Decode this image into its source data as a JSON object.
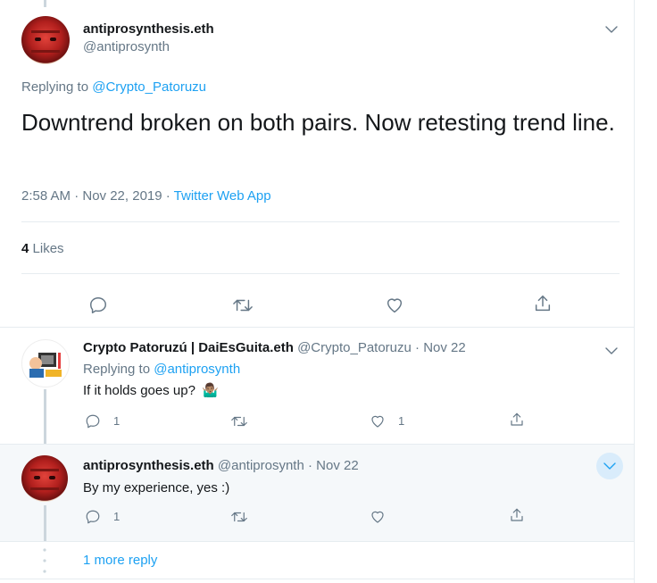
{
  "main_tweet": {
    "display_name": "antiprosynthesis.eth",
    "handle": "@antiprosynth",
    "replying_prefix": "Replying to",
    "replying_to": "@Crypto_Patoruzu",
    "text": "Downtrend broken on both pairs. Now retesting trend line.",
    "time": "2:58 AM · Nov 22, 2019 ·",
    "source": "Twitter Web App",
    "likes_count": "4",
    "likes_label": "Likes"
  },
  "reply1": {
    "display_name": "Crypto Patoruzú | DaiEsGuita.eth",
    "handle_date": "@Crypto_Patoruzu · Nov 22",
    "replying_prefix": "Replying to",
    "replying_to": "@antiprosynth",
    "text": "If it holds goes up?",
    "emoji": "🤷🏽‍♂️",
    "reply_count": "1",
    "like_count": "1"
  },
  "reply2": {
    "display_name": "antiprosynthesis.eth",
    "handle_date": "@antiprosynth · Nov 22",
    "text": "By my experience, yes :)",
    "reply_count": "1"
  },
  "more_replies": "1 more reply",
  "colors": {
    "link": "#1da1f2",
    "muted": "#657786",
    "separator": "#e6ecf0",
    "highlight_bg": "#f5f8fa"
  },
  "icons": [
    "reply-icon",
    "retweet-icon",
    "like-icon",
    "share-icon",
    "chevron-down-icon",
    "more-dots-icon"
  ]
}
